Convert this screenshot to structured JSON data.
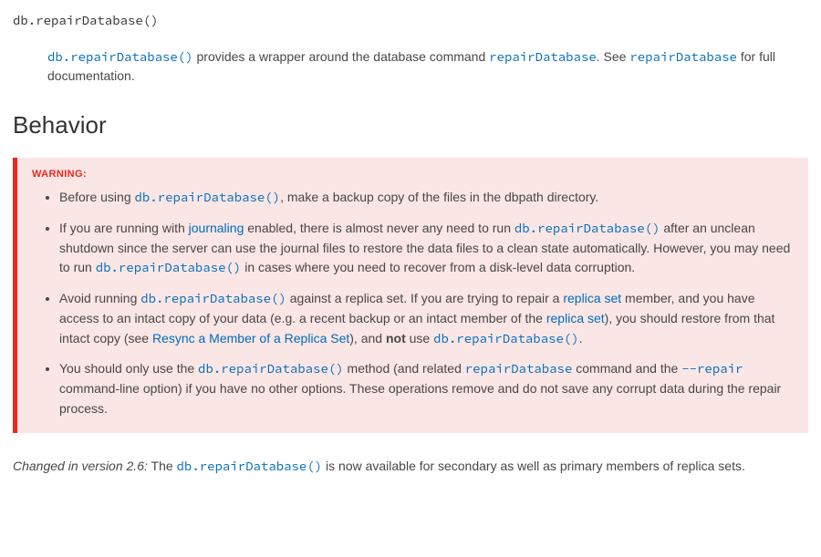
{
  "signature": "db.repairDatabase()",
  "desc": {
    "method1": "db.repairDatabase()",
    "t1": " provides a wrapper around the database command ",
    "cmd1": "repairDatabase",
    "t2": ". See ",
    "cmd2": "repairDatabase",
    "t3": " for full documentation."
  },
  "heading_behavior": "Behavior",
  "warning": {
    "title": "WARNING:",
    "b1": {
      "t1": "Before using ",
      "m1": "db.repairDatabase()",
      "t2": ", make a backup copy of the files in the dbpath directory."
    },
    "b2": {
      "t1": "If you are running with ",
      "l1": "journaling",
      "t2": " enabled, there is almost never any need to run ",
      "m1": "db.repairDatabase()",
      "t3": " after an unclean shutdown since the server can use the journal files to restore the data files to a clean state automatically. However, you may need to run ",
      "m2": "db.repairDatabase()",
      "t4": " in cases where you need to recover from a disk-level data corruption."
    },
    "b3": {
      "t1": "Avoid running ",
      "m1": "db.repairDatabase()",
      "t2": " against a replica set. If you are trying to repair a ",
      "l1": "replica set",
      "t3": " member, and you have access to an intact copy of your data (e.g. a recent backup or an intact member of the ",
      "l2": "replica set",
      "t4": "), you should restore from that intact copy (see ",
      "l3": "Resync a Member of a Replica Set",
      "t5": "), and ",
      "strong": "not",
      "t6": " use ",
      "m2": "db.repairDatabase()",
      "t7": "."
    },
    "b4": {
      "t1": "You should only use the ",
      "m1": "db.repairDatabase()",
      "t2": " method (and related ",
      "m2": "repairDatabase",
      "t3": " command and the ",
      "m3": "--repair",
      "t4": " command-line option) if you have no other options. These operations remove and do not save any corrupt data during the repair process."
    }
  },
  "changed": {
    "label": "Changed in version 2.6:",
    "t1": " The ",
    "m1": "db.repairDatabase()",
    "t2": " is now available for secondary as well as primary members of replica sets."
  }
}
